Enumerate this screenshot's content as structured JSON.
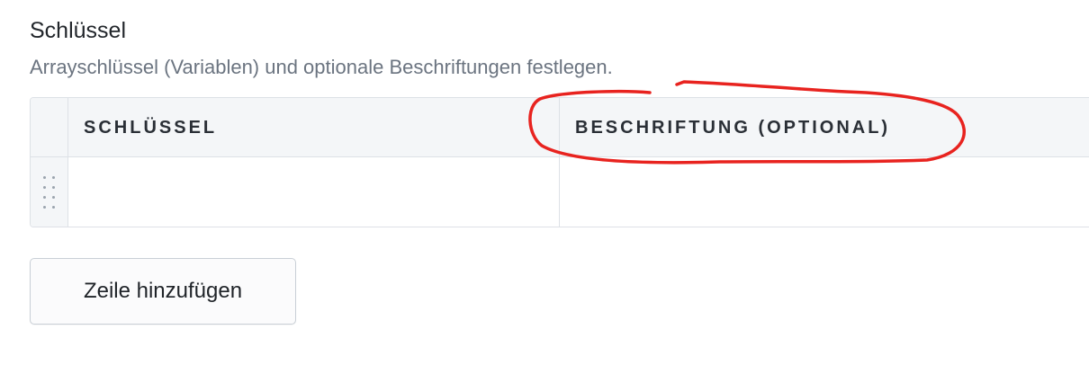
{
  "field": {
    "title": "Schlüssel",
    "description": "Arrayschlüssel (Variablen) und optionale Beschriftungen festlegen."
  },
  "table": {
    "columns": [
      {
        "label": "SCHLÜSSEL"
      },
      {
        "label": "BESCHRIFTUNG (OPTIONAL)"
      }
    ],
    "rows": [
      {
        "key": "",
        "label": ""
      }
    ]
  },
  "actions": {
    "add_row_label": "Zeile hinzufügen"
  },
  "colors": {
    "annotation_stroke": "#e8231f",
    "header_bg": "#f4f6f8",
    "border": "#dde1e6"
  },
  "icons": {
    "drag_handle": "drag-handle-icon"
  }
}
